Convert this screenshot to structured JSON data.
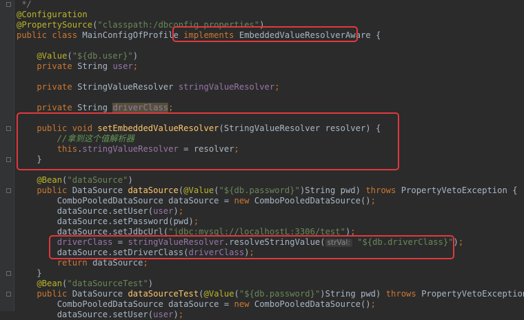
{
  "editor": {
    "lines": [
      [
        {
          "t": " */",
          "c": "cmgray"
        }
      ],
      [
        {
          "t": "@Configuration",
          "c": "anno"
        }
      ],
      [
        {
          "t": "@PropertySource",
          "c": "anno"
        },
        {
          "t": "(",
          "c": "id"
        },
        {
          "t": "\"classpath:/dbconfig.properties\"",
          "c": "str"
        },
        {
          "t": ")",
          "c": "id"
        }
      ],
      [
        {
          "t": "public class ",
          "c": "kw"
        },
        {
          "t": "MainConfigOfProfile ",
          "c": "id"
        },
        {
          "t": "implements ",
          "c": "kw"
        },
        {
          "t": "EmbeddedValueResolverAware ",
          "c": "id"
        },
        {
          "t": "{",
          "c": "id"
        }
      ],
      [],
      [
        {
          "t": "    @Value",
          "c": "anno"
        },
        {
          "t": "(",
          "c": "id"
        },
        {
          "t": "\"${db.user}\"",
          "c": "str"
        },
        {
          "t": ")",
          "c": "id"
        }
      ],
      [
        {
          "t": "    private ",
          "c": "kw"
        },
        {
          "t": "String ",
          "c": "id"
        },
        {
          "t": "user",
          "c": "fld"
        },
        {
          "t": ";",
          "c": "kw"
        }
      ],
      [],
      [
        {
          "t": "    private ",
          "c": "kw"
        },
        {
          "t": "StringValueResolver ",
          "c": "id"
        },
        {
          "t": "stringValueResolver",
          "c": "fld"
        },
        {
          "t": ";",
          "c": "kw"
        }
      ],
      [],
      [
        {
          "t": "    private ",
          "c": "kw"
        },
        {
          "t": "String ",
          "c": "id"
        },
        {
          "t": "driverClass",
          "c": "fld warnbg"
        },
        {
          "t": ";",
          "c": "kw"
        }
      ],
      [],
      [
        {
          "t": "    public void ",
          "c": "kw"
        },
        {
          "t": "setEmbeddedValueResolver",
          "c": "fn"
        },
        {
          "t": "(StringValueResolver resolver) {",
          "c": "id"
        }
      ],
      [
        {
          "t": "        //",
          "c": "cm"
        },
        {
          "t": "拿到这个值解析器",
          "c": "cn"
        }
      ],
      [
        {
          "t": "        this",
          "c": "kw"
        },
        {
          "t": ".",
          "c": "id"
        },
        {
          "t": "stringValueResolver",
          "c": "fld"
        },
        {
          "t": " = resolver",
          "c": "id"
        },
        {
          "t": ";",
          "c": "kw"
        }
      ],
      [
        {
          "t": "    }",
          "c": "id"
        }
      ],
      [],
      [
        {
          "t": "    @Bean",
          "c": "anno"
        },
        {
          "t": "(",
          "c": "id"
        },
        {
          "t": "\"dataSource\"",
          "c": "str"
        },
        {
          "t": ")",
          "c": "id"
        }
      ],
      [
        {
          "t": "    public ",
          "c": "kw"
        },
        {
          "t": "DataSource ",
          "c": "id"
        },
        {
          "t": "dataSource",
          "c": "fn"
        },
        {
          "t": "(",
          "c": "id"
        },
        {
          "t": "@Value",
          "c": "anno"
        },
        {
          "t": "(",
          "c": "id"
        },
        {
          "t": "\"${db.password}\"",
          "c": "str"
        },
        {
          "t": ")String pwd) ",
          "c": "id"
        },
        {
          "t": "throws ",
          "c": "kw"
        },
        {
          "t": "PropertyVetoException {",
          "c": "id"
        }
      ],
      [
        {
          "t": "        ComboPooledDataSource dataSource = ",
          "c": "id"
        },
        {
          "t": "new ",
          "c": "kw"
        },
        {
          "t": "ComboPooledDataSource()",
          "c": "id"
        },
        {
          "t": ";",
          "c": "kw"
        }
      ],
      [
        {
          "t": "        dataSource.setUser(",
          "c": "id"
        },
        {
          "t": "user",
          "c": "fld"
        },
        {
          "t": ")",
          "c": "id"
        },
        {
          "t": ";",
          "c": "kw"
        }
      ],
      [
        {
          "t": "        dataSource.setPassword(pwd)",
          "c": "id"
        },
        {
          "t": ";",
          "c": "kw"
        }
      ],
      [
        {
          "t": "        dataSource.setJdbcUrl(",
          "c": "id"
        },
        {
          "t": "\"jdbc:mysql://localhostL:3306/test\"",
          "c": "str"
        },
        {
          "t": ")",
          "c": "id"
        },
        {
          "t": ";",
          "c": "kw"
        }
      ],
      [
        {
          "t": "        ",
          "c": "id"
        },
        {
          "t": "driverClass",
          "c": "fld"
        },
        {
          "t": " = ",
          "c": "id"
        },
        {
          "t": "stringValueResolver",
          "c": "fld"
        },
        {
          "t": ".resolveStringValue(",
          "c": "id"
        },
        {
          "t": "strVal:",
          "c": "hintbox"
        },
        {
          "t": " ",
          "c": "id"
        },
        {
          "t": "\"${db.driverClass}\"",
          "c": "str"
        },
        {
          "t": ")",
          "c": "id"
        },
        {
          "t": ";",
          "c": "kw"
        }
      ],
      [
        {
          "t": "        dataSource.setDriverClass(",
          "c": "id"
        },
        {
          "t": "driverClass",
          "c": "fld"
        },
        {
          "t": ")",
          "c": "id"
        },
        {
          "t": ";",
          "c": "kw"
        }
      ],
      [
        {
          "t": "        return ",
          "c": "kw"
        },
        {
          "t": "dataSource",
          "c": "id"
        },
        {
          "t": ";",
          "c": "kw"
        }
      ],
      [
        {
          "t": "    }",
          "c": "id"
        }
      ],
      [
        {
          "t": "    @Bean",
          "c": "anno"
        },
        {
          "t": "(",
          "c": "id"
        },
        {
          "t": "\"dataSourceTest\"",
          "c": "str"
        },
        {
          "t": ")",
          "c": "id"
        }
      ],
      [
        {
          "t": "    public ",
          "c": "kw"
        },
        {
          "t": "DataSource ",
          "c": "id"
        },
        {
          "t": "dataSourceTest",
          "c": "fn"
        },
        {
          "t": "(",
          "c": "id"
        },
        {
          "t": "@Value",
          "c": "anno"
        },
        {
          "t": "(",
          "c": "id"
        },
        {
          "t": "\"${db.password}\"",
          "c": "str"
        },
        {
          "t": ")String pwd) ",
          "c": "id"
        },
        {
          "t": "throws ",
          "c": "kw"
        },
        {
          "t": "PropertyVetoException {",
          "c": "id"
        }
      ],
      [
        {
          "t": "        ComboPooledDataSource dataSource = ",
          "c": "id"
        },
        {
          "t": "new ",
          "c": "kw"
        },
        {
          "t": "ComboPooledDataSource()",
          "c": "id"
        },
        {
          "t": ";",
          "c": "kw"
        }
      ],
      [
        {
          "t": "        dataSource.setUser(",
          "c": "id"
        },
        {
          "t": "user",
          "c": "fld"
        },
        {
          "t": ")",
          "c": "id"
        },
        {
          "t": ";",
          "c": "kw"
        }
      ]
    ]
  }
}
